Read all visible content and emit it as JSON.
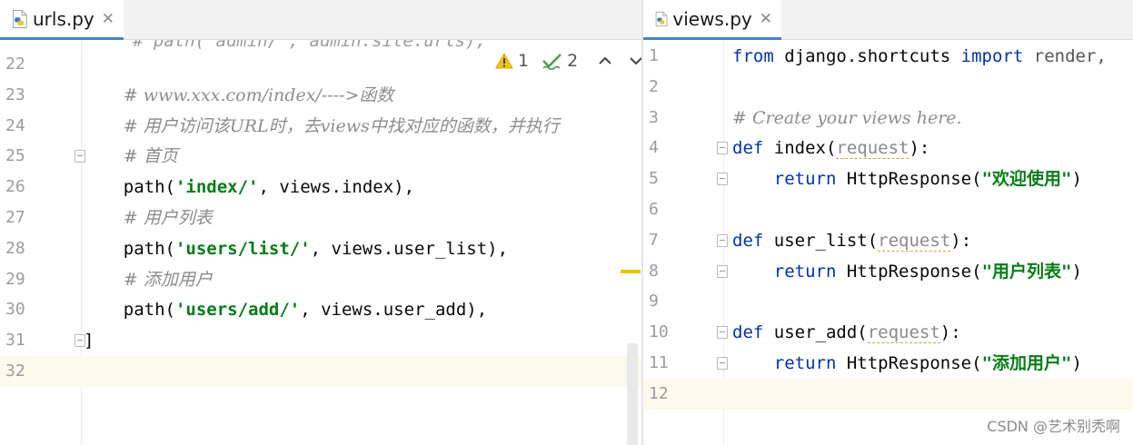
{
  "left_editor": {
    "tab": {
      "label": "urls.py",
      "icon": "python-file-icon",
      "close": "✕"
    },
    "inspections": {
      "warnings": "1",
      "weak_warnings": "2"
    },
    "cut_line_text": "# path('admin/', admin.site.urls),",
    "lines": [
      {
        "n": "22",
        "text": ""
      },
      {
        "n": "23",
        "text": "# www.xxx.com/index/---->函数"
      },
      {
        "n": "24",
        "text": "# 用户访问该URL时，去views中找对应的函数，并执行"
      },
      {
        "n": "25",
        "text": "# 首页"
      },
      {
        "n": "26",
        "pre": "path(",
        "str": "'index/'",
        "post": ", views.index),"
      },
      {
        "n": "27",
        "text": "# 用户列表"
      },
      {
        "n": "28",
        "pre": "path(",
        "str": "'users/list/'",
        "post": ", views.user_list),"
      },
      {
        "n": "29",
        "text": "# 添加用户"
      },
      {
        "n": "30",
        "pre": "path(",
        "str": "'users/add/'",
        "post": ", views.user_add),"
      },
      {
        "n": "31",
        "text": "]"
      },
      {
        "n": "32",
        "text": ""
      }
    ]
  },
  "right_editor": {
    "tab": {
      "label": "views.py",
      "icon": "python-file-icon",
      "close": "✕"
    },
    "lines": [
      {
        "n": "1",
        "kw1": "from",
        "mid": " django.shortcuts ",
        "kw2": "import",
        "rest": " render,"
      },
      {
        "n": "2",
        "text": ""
      },
      {
        "n": "3",
        "text": "# Create your views here."
      },
      {
        "n": "4",
        "kw": "def",
        "name": " index(",
        "param": "request",
        "end": "):"
      },
      {
        "n": "5",
        "kw": "return",
        "pre": " HttpResponse(",
        "str": "\"欢迎使用\"",
        "end": ")"
      },
      {
        "n": "6",
        "text": ""
      },
      {
        "n": "7",
        "kw": "def",
        "name": " user_list(",
        "param": "request",
        "end": "):"
      },
      {
        "n": "8",
        "kw": "return",
        "pre": " HttpResponse(",
        "str": "\"用户列表\"",
        "end": ")"
      },
      {
        "n": "9",
        "text": ""
      },
      {
        "n": "10",
        "kw": "def",
        "name": " user_add(",
        "param": "request",
        "end": "):"
      },
      {
        "n": "11",
        "kw": "return",
        "pre": " HttpResponse(",
        "str": "\"添加用户\"",
        "end": ")"
      },
      {
        "n": "12",
        "text": ""
      }
    ]
  },
  "watermark": "CSDN @艺术别秃啊",
  "colors": {
    "keyword": "#0033b3",
    "string": "#067d17",
    "comment": "#8c8c8c",
    "current_line": "#fcfaed",
    "tab_underline": "#4a83c4",
    "warning": "#e6b800",
    "typo_check": "#4a9a4a"
  }
}
